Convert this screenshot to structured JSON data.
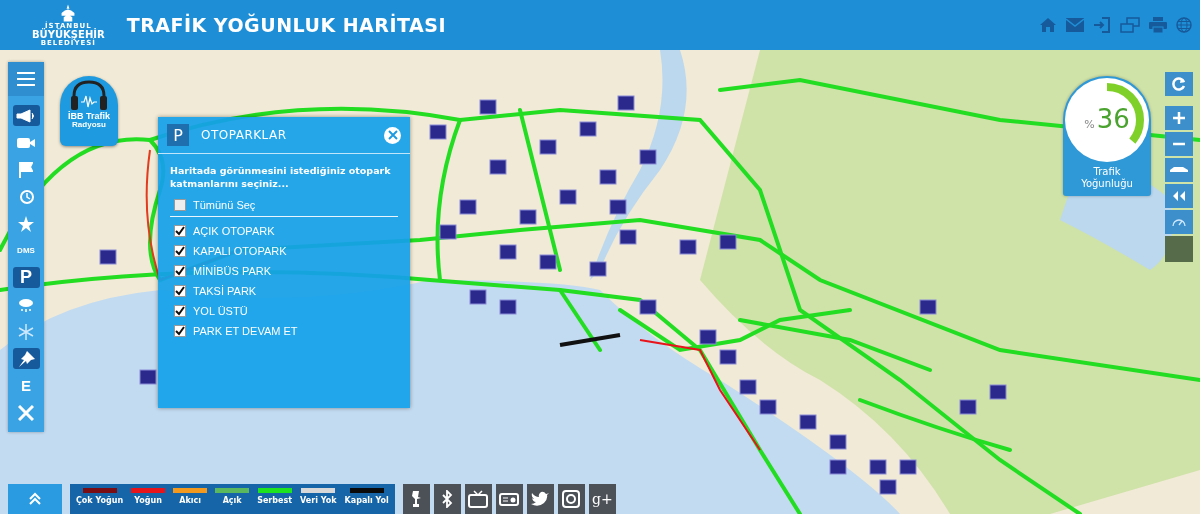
{
  "header": {
    "title": "TRAFİK YOĞUNLUK HARİTASI",
    "logo_lines": [
      "İSTANBUL",
      "BÜYÜKŞEHİR",
      "BELEDİYESİ"
    ]
  },
  "sidebar": {
    "items": [
      {
        "kind": "megaphone",
        "selected": true
      },
      {
        "kind": "camera",
        "selected": false
      },
      {
        "kind": "flag",
        "selected": false
      },
      {
        "kind": "history",
        "selected": false
      },
      {
        "kind": "star",
        "selected": false
      },
      {
        "kind": "text",
        "label": "DMS",
        "selected": false
      },
      {
        "kind": "parking",
        "label": "P",
        "selected": true
      },
      {
        "kind": "weather",
        "selected": false
      },
      {
        "kind": "snow",
        "selected": false
      },
      {
        "kind": "pin",
        "selected": true
      },
      {
        "kind": "text",
        "label": "E",
        "selected": false
      },
      {
        "kind": "tools",
        "selected": false
      }
    ]
  },
  "radio": {
    "lines": [
      "İBB Trafik",
      "Radyosu"
    ]
  },
  "panel": {
    "icon": "P",
    "title": "OTOPARKLAR",
    "description": "Haritada görünmesini istediğiniz otopark katmanlarını seçiniz...",
    "select_all": {
      "label": "Tümünü Seç",
      "checked": false
    },
    "layers": [
      {
        "label": "AÇIK OTOPARK",
        "checked": true
      },
      {
        "label": "KAPALI OTOPARK",
        "checked": true
      },
      {
        "label": "MİNİBÜS PARK",
        "checked": true
      },
      {
        "label": "TAKSİ PARK",
        "checked": true
      },
      {
        "label": "YOL ÜSTÜ",
        "checked": true
      },
      {
        "label": "PARK ET DEVAM ET",
        "checked": true
      }
    ]
  },
  "gauge": {
    "unit": "%",
    "value": "36",
    "level": 0.36,
    "label": "Trafik Yoğunluğu"
  },
  "legend": [
    {
      "label": "Çok Yoğun",
      "color": "#7a0c14"
    },
    {
      "label": "Yoğun",
      "color": "#e8141c"
    },
    {
      "label": "Akıcı",
      "color": "#f39a1e"
    },
    {
      "label": "Açık",
      "color": "#5cb85c"
    },
    {
      "label": "Serbest",
      "color": "#1fe21f"
    },
    {
      "label": "Veri Yok",
      "color": "#d8d8d8"
    },
    {
      "label": "Kapalı Yol",
      "color": "#0a0a0a"
    }
  ],
  "social": [
    {
      "kind": "statue"
    },
    {
      "kind": "bluetooth"
    },
    {
      "kind": "tv"
    },
    {
      "kind": "radio"
    },
    {
      "kind": "twitter"
    },
    {
      "kind": "instagram"
    },
    {
      "kind": "text",
      "label": "g+"
    }
  ]
}
